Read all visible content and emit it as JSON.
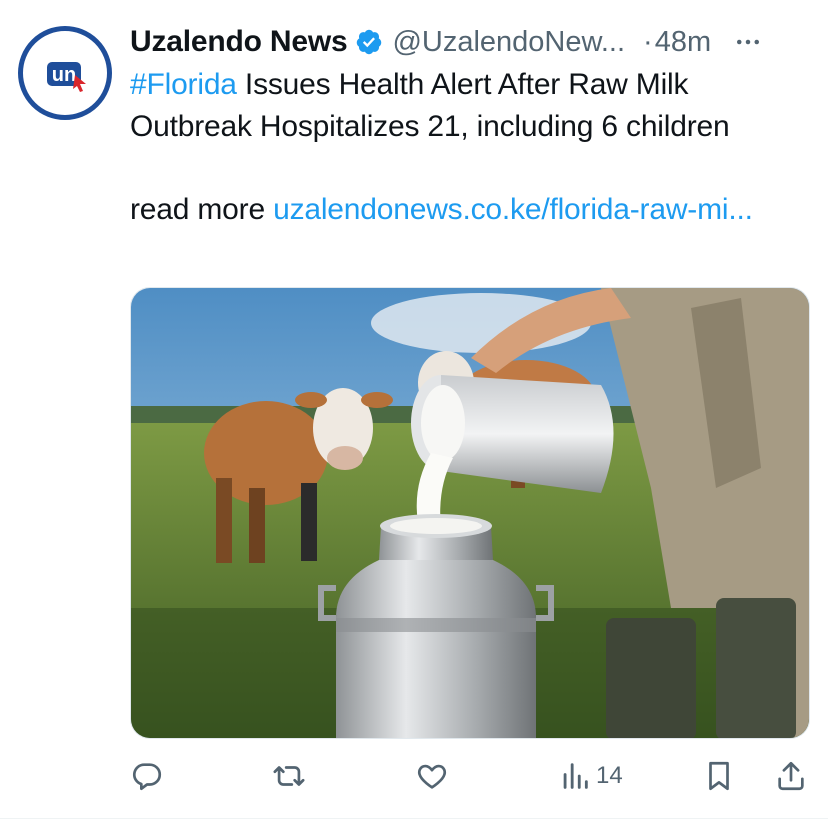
{
  "account": {
    "display_name": "Uzalendo News",
    "handle": "@UzalendoNew...",
    "separator": "·",
    "timestamp": "48m",
    "avatar_text": "un",
    "verified_icon": "verified-badge-icon"
  },
  "post": {
    "hashtag": "#Florida",
    "headline_rest": " Issues Health Alert After Raw Milk Outbreak Hospitalizes 21, including 6 children",
    "read_more_label": "read more ",
    "link_text": "uzalendonews.co.ke/florida-raw-mi..."
  },
  "media": {
    "description_icon": "photo-raw-milk-pouring"
  },
  "actions": {
    "reply_icon": "reply-icon",
    "repost_icon": "repost-icon",
    "like_icon": "like-icon",
    "views_icon": "views-icon",
    "views_count": "14",
    "bookmark_icon": "bookmark-icon",
    "share_icon": "share-icon"
  },
  "colors": {
    "link": "#1d9bf0",
    "muted": "#536471",
    "text": "#0f1419",
    "avatar_ring": "#1f4e9a",
    "avatar_accent": "#d9262c"
  }
}
